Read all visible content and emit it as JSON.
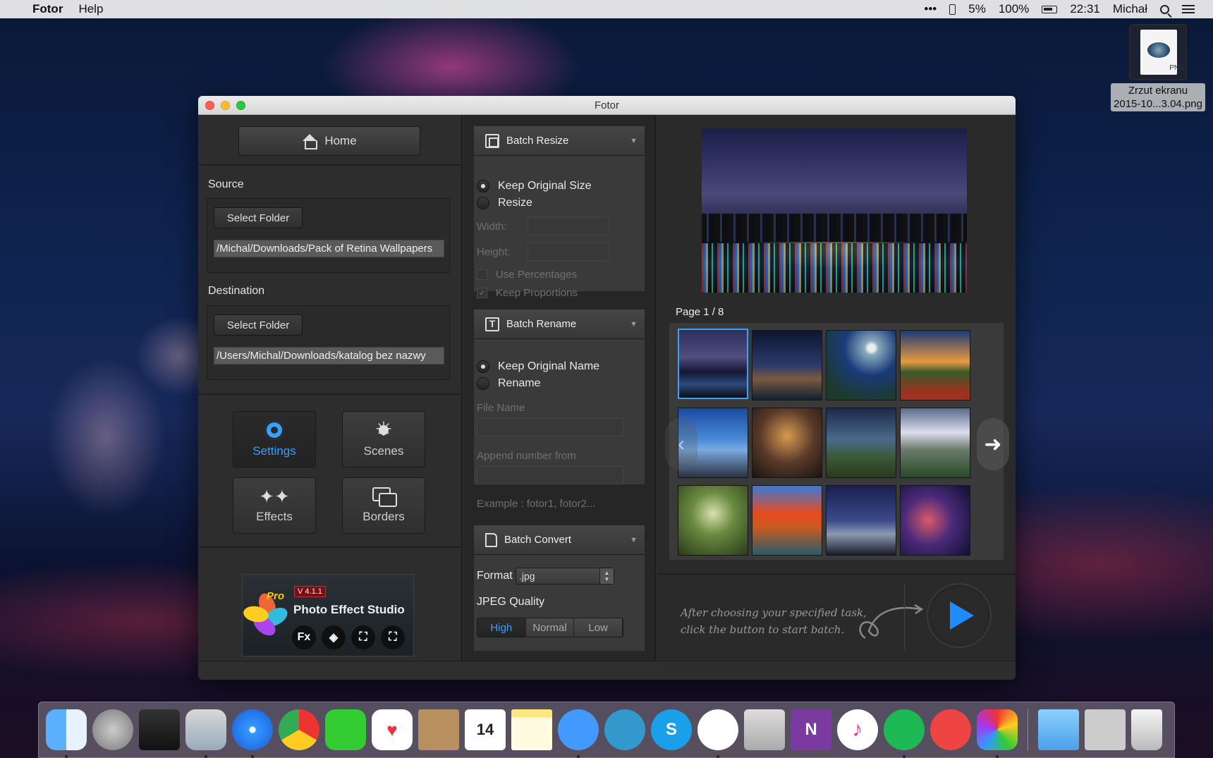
{
  "menubar": {
    "app_name": "Fotor",
    "menus": [
      "Help"
    ],
    "status": {
      "more": "•••",
      "phone_battery": "5%",
      "battery": "100%",
      "time": "22:31",
      "user": "Michał"
    }
  },
  "desktop": {
    "file_icon": {
      "type_label": "PNG",
      "name_line1": "Zrzut ekranu",
      "name_line2": "2015-10...3.04.png"
    }
  },
  "window": {
    "title": "Fotor",
    "left": {
      "home_label": "Home",
      "source": {
        "label": "Source",
        "button": "Select Folder",
        "path": "/Michal/Downloads/Pack of Retina Wallpapers"
      },
      "destination": {
        "label": "Destination",
        "button": "Select Folder",
        "path": "/Users/Michal/Downloads/katalog bez nazwy"
      },
      "tools": [
        {
          "label": "Settings",
          "icon": "gear-icon",
          "active": true
        },
        {
          "label": "Scenes",
          "icon": "sun-icon",
          "active": false
        },
        {
          "label": "Effects",
          "icon": "sparkle-icon",
          "active": false
        },
        {
          "label": "Borders",
          "icon": "borders-icon",
          "active": false
        }
      ],
      "promo": {
        "version": "V 4.1.1",
        "pro": "Pro",
        "title": "Photo Effect Studio",
        "icons": [
          "Fx",
          "◈",
          "⛶",
          "⛶"
        ]
      }
    },
    "middle": {
      "resize": {
        "title": "Batch Resize",
        "options": [
          "Keep Original Size",
          "Resize"
        ],
        "selected": 0,
        "width_label": "Width:",
        "height_label": "Height:",
        "use_percentages": "Use Percentages",
        "keep_proportions": "Keep Proportions"
      },
      "rename": {
        "title": "Batch Rename",
        "options": [
          "Keep Original Name",
          "Rename"
        ],
        "selected": 0,
        "file_name_label": "File Name",
        "append_label": "Append number from",
        "example": "Example : fotor1, fotor2..."
      },
      "convert": {
        "title": "Batch Convert",
        "format_label": "Format",
        "format_value": ".jpg",
        "quality_label": "JPEG Quality",
        "quality_options": [
          "High",
          "Normal",
          "Low"
        ],
        "quality_selected": 0
      }
    },
    "right": {
      "page_label": "Page 1 / 8",
      "hint_line1": "After choosing your specified task,",
      "hint_line2": "click the button to start batch."
    }
  },
  "colors": {
    "accent": "#3aa0ff",
    "play": "#1e8cff"
  }
}
